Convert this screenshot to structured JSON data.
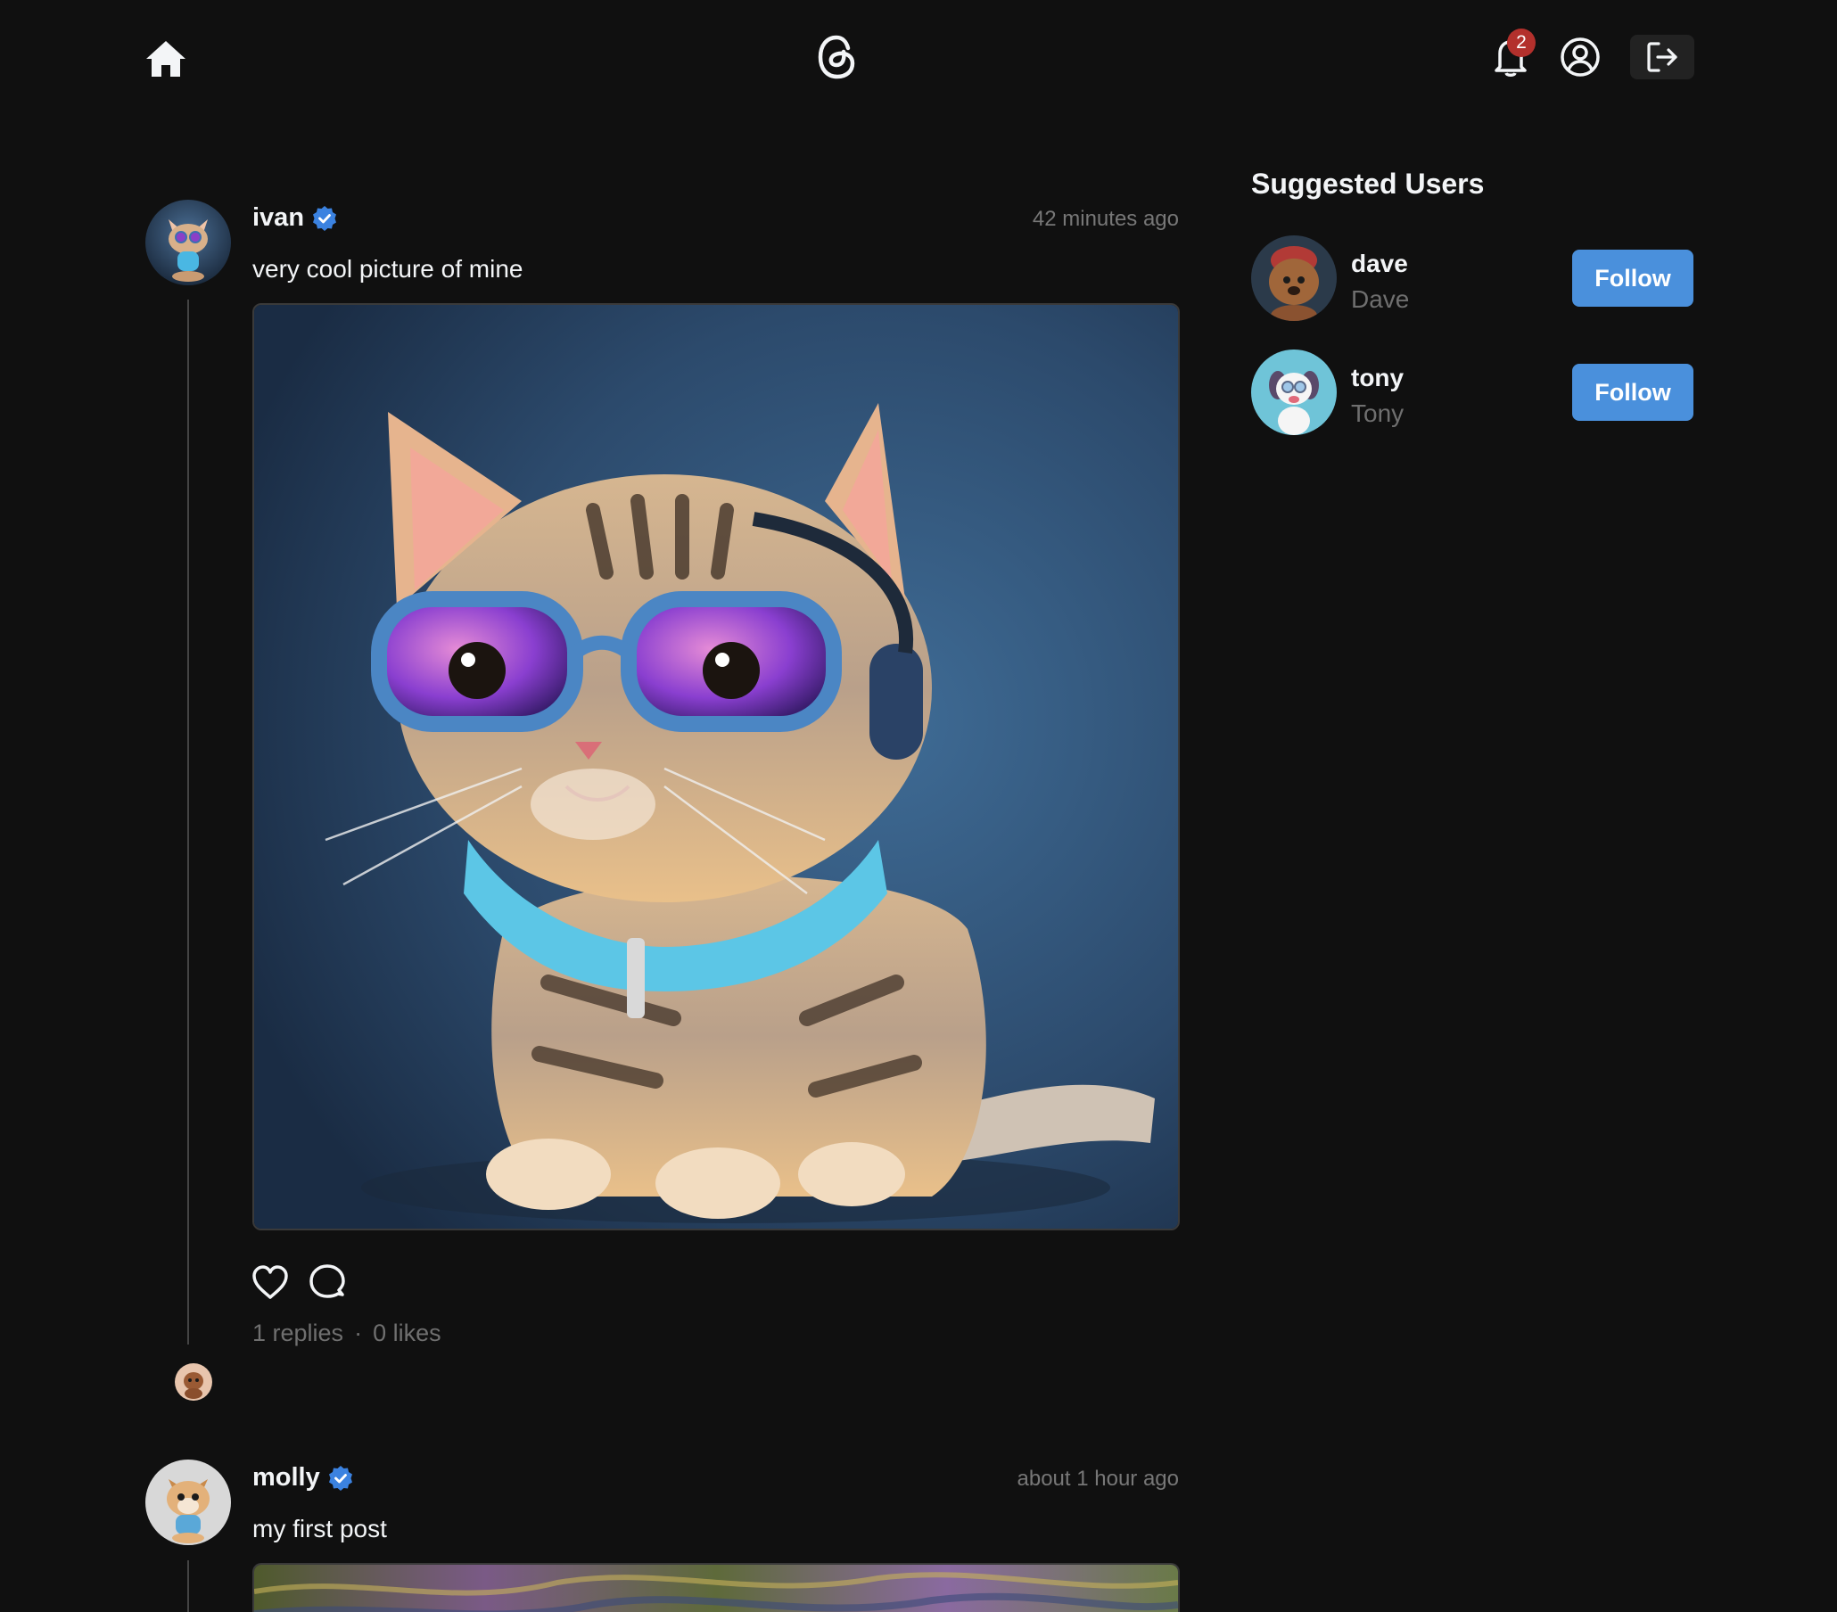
{
  "header": {
    "notification_count": "2",
    "home_icon": "home-icon",
    "logo_icon": "threads-logo-icon",
    "bell_icon": "bell-icon",
    "user_icon": "user-circle-icon",
    "logout_icon": "logout-icon"
  },
  "posts": [
    {
      "username": "ivan",
      "verified": true,
      "time": "42 minutes ago",
      "text": "very cool picture of mine",
      "image_desc": "cat",
      "replies": "1 replies",
      "likes": "0 likes"
    },
    {
      "username": "molly",
      "verified": true,
      "time": "about 1 hour ago",
      "text": "my first post"
    }
  ],
  "sidebar": {
    "title": "Suggested Users",
    "users": [
      {
        "username": "dave",
        "name": "Dave",
        "follow_label": "Follow"
      },
      {
        "username": "tony",
        "name": "Tony",
        "follow_label": "Follow"
      }
    ]
  },
  "colors": {
    "background": "#101010",
    "accent": "#4a90dc",
    "badge": "#b3302c",
    "verified": "#3b82e0"
  }
}
